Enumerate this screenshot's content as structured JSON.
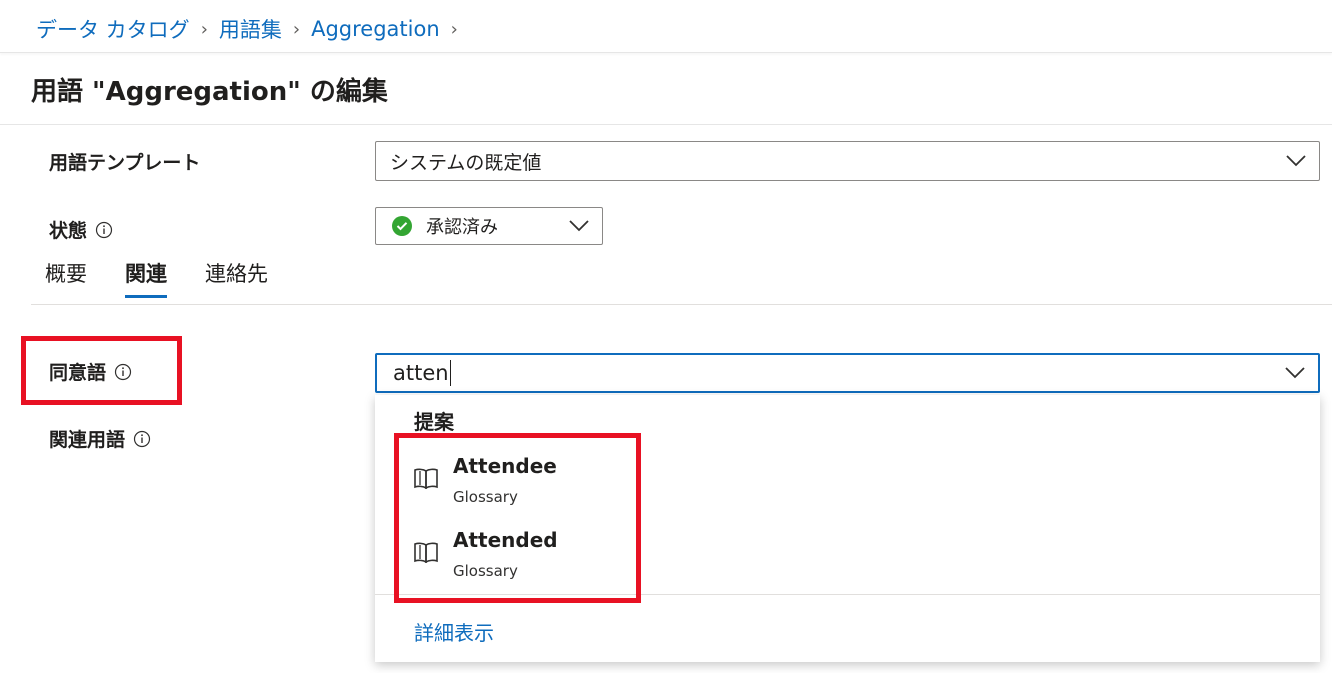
{
  "breadcrumb": {
    "items": [
      "データ カタログ",
      "用語集",
      "Aggregation"
    ],
    "separator": "›"
  },
  "title": "用語 \"Aggregation\" の編集",
  "template": {
    "label": "用語テンプレート",
    "value": "システムの既定値"
  },
  "status": {
    "label": "状態",
    "value": "承認済み",
    "color": "#33a532"
  },
  "tabs": [
    {
      "label": "概要",
      "active": false
    },
    {
      "label": "関連",
      "active": true
    },
    {
      "label": "連絡先",
      "active": false
    }
  ],
  "synonyms": {
    "label": "同意語",
    "input_value": "atten"
  },
  "related_terms": {
    "label": "関連用語"
  },
  "suggestions": {
    "header": "提案",
    "items": [
      {
        "name": "Attendee",
        "source": "Glossary",
        "icon": "book-icon"
      },
      {
        "name": "Attended",
        "source": "Glossary",
        "icon": "book-icon"
      }
    ],
    "more_label": "詳細表示"
  },
  "colors": {
    "accent": "#0f6cbd",
    "highlight": "#e81123"
  }
}
